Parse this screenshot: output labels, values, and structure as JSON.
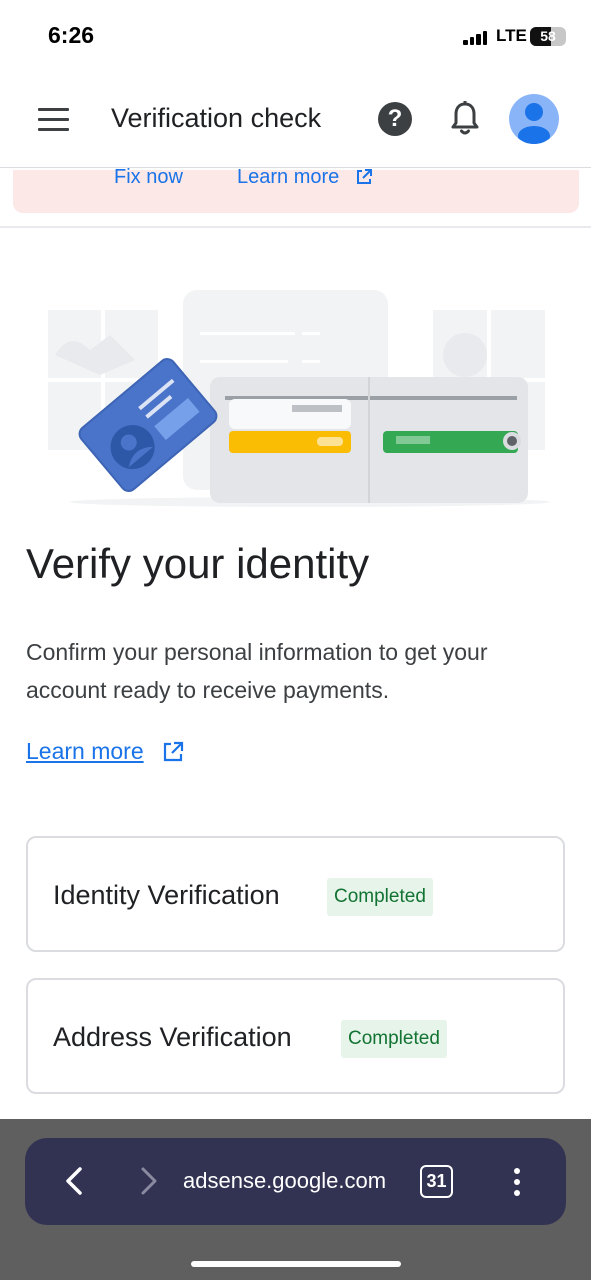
{
  "status_bar": {
    "time": "6:26",
    "network": "LTE",
    "battery": "58"
  },
  "app_bar": {
    "title": "Verification check",
    "help_icon": "help-circle-icon",
    "notifications_icon": "bell-icon",
    "avatar_icon": "account-avatar-icon"
  },
  "alert": {
    "fix_label": "Fix now",
    "learn_more_label": "Learn more"
  },
  "main": {
    "headline": "Verify your identity",
    "description": "Confirm your personal information to get your account ready to receive payments.",
    "learn_more_label": "Learn more"
  },
  "verifications": [
    {
      "title": "Identity Verification",
      "status": "Completed"
    },
    {
      "title": "Address Verification",
      "status": "Completed"
    }
  ],
  "browser": {
    "url": "adsense.google.com",
    "tab_count": "31"
  },
  "colors": {
    "link": "#1a73e8",
    "badge_bg": "#e6f4ea",
    "badge_text": "#137333",
    "alert_bg": "#fce8e6",
    "browser_bar": "#323352"
  }
}
